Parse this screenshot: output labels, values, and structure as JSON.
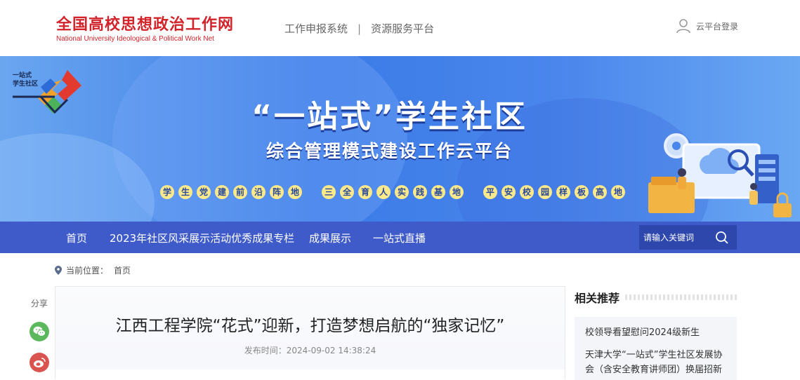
{
  "header": {
    "logo_cn": "全国高校思想政治工作网",
    "logo_en": "National University Ideological & Political Work Net",
    "links": [
      "工作申报系统",
      "资源服务平台"
    ],
    "separator": "|",
    "login_label": "云平台登录"
  },
  "banner": {
    "badge_line1": "一站式",
    "badge_line2": "学生社区",
    "title": "“一站式”学生社区",
    "subtitle": "综合管理模式建设工作云平台",
    "slogans": [
      [
        "学",
        "生",
        "党",
        "建",
        "前",
        "沿",
        "阵",
        "地"
      ],
      [
        "三",
        "全",
        "育",
        "人",
        "实",
        "践",
        "基",
        "地"
      ],
      [
        "平",
        "安",
        "校",
        "园",
        "样",
        "板",
        "高",
        "地"
      ]
    ]
  },
  "nav": {
    "items": [
      "首页",
      "2023年社区风采展示活动优秀成果专栏",
      "成果展示",
      "一站式直播"
    ],
    "search_placeholder": "请输入关键词"
  },
  "breadcrumb": {
    "label": "当前位置：",
    "home": "首页"
  },
  "share": {
    "label": "分享"
  },
  "article": {
    "title": "江西工程学院“花式”迎新，打造梦想启航的“独家记忆”",
    "meta_label": "发布时间：",
    "publish_time": "2024-09-02 14:38:24"
  },
  "sidebar": {
    "title": "相关推荐",
    "items": [
      "校领导看望慰问2024级新生",
      "天津大学“一站式”学生社区发展协会（含安全教育讲师团）换届招新"
    ]
  },
  "colors": {
    "brand_red": "#d2232a",
    "nav_blue": "#3f5bc9",
    "banner_blue": "#3b7be6",
    "slogan_yellow": "#fbe98c"
  }
}
